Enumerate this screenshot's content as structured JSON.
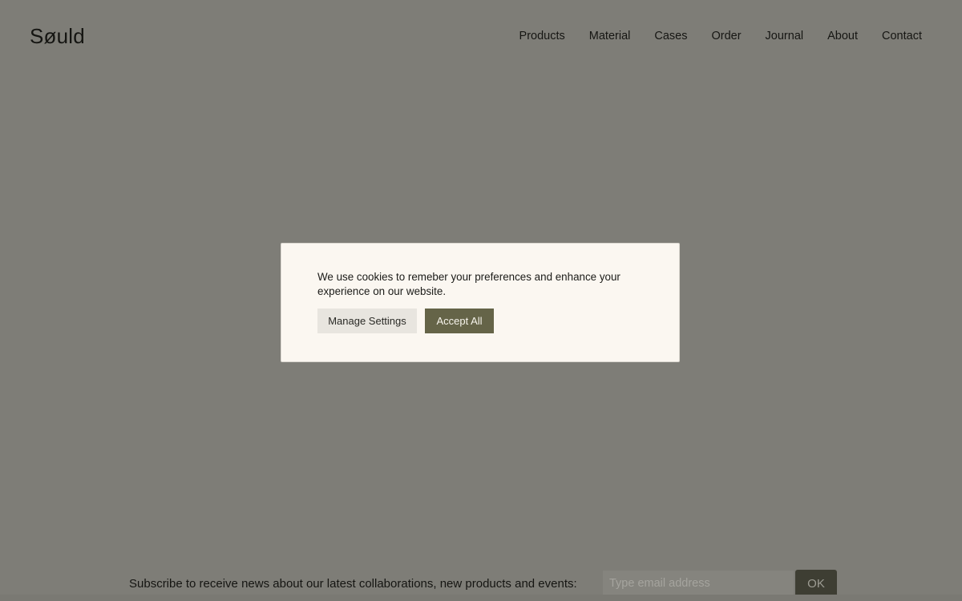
{
  "header": {
    "logo": "Søuld",
    "nav": [
      {
        "label": "Products"
      },
      {
        "label": "Material"
      },
      {
        "label": "Cases"
      },
      {
        "label": "Order"
      },
      {
        "label": "Journal"
      },
      {
        "label": "About"
      },
      {
        "label": "Contact"
      }
    ]
  },
  "cookie_modal": {
    "message": "We use cookies to remeber your preferences and enhance your experience on our website.",
    "manage_label": "Manage Settings",
    "accept_label": "Accept All"
  },
  "subscribe": {
    "text": "Subscribe to receive news about our latest collaborations, new products and events:",
    "email_placeholder": "Type email address",
    "ok_label": "OK"
  },
  "colors": {
    "overlay_bg": "#7e7d77",
    "modal_bg": "#fbf7f1",
    "accent": "#656448",
    "ok_button_bg": "#3e3e33"
  }
}
